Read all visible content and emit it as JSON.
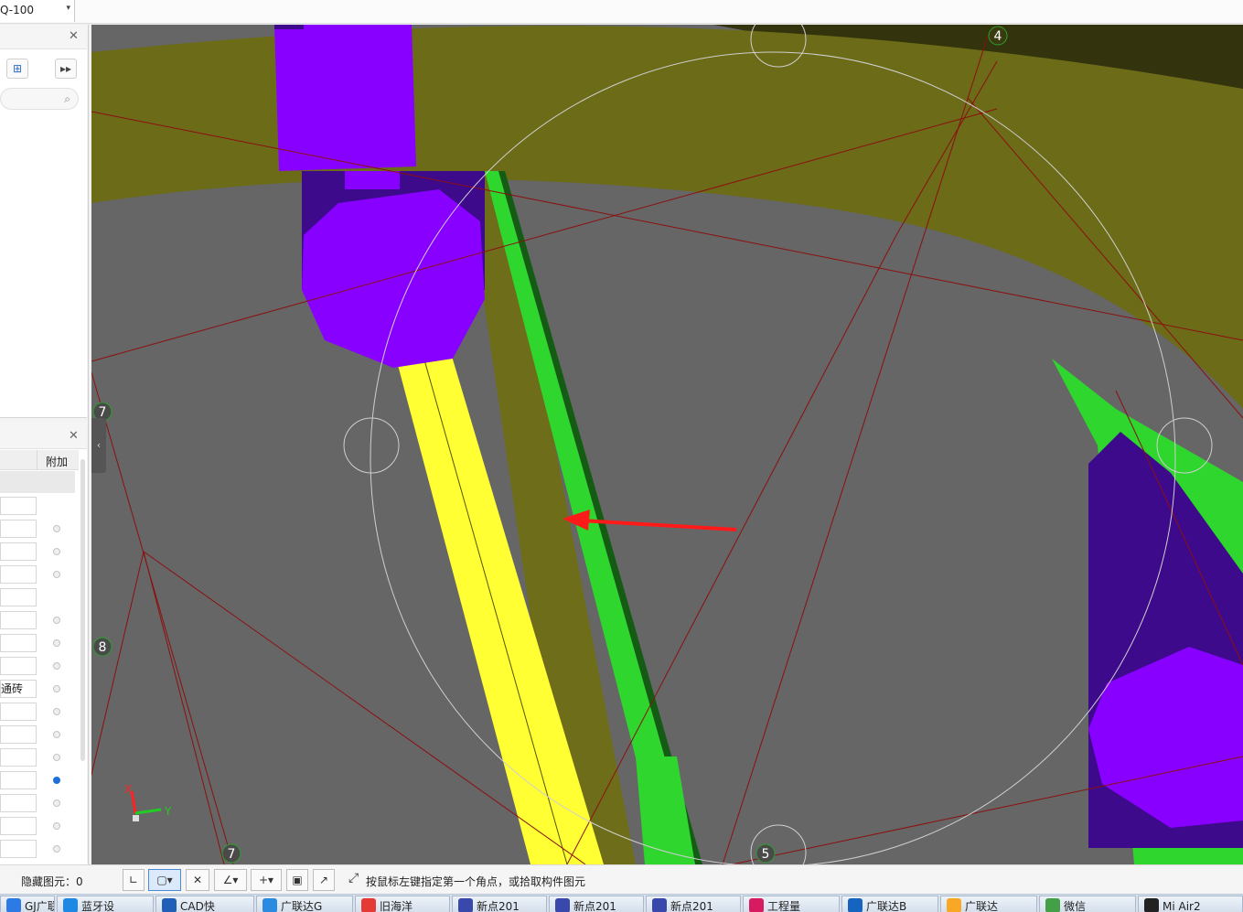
{
  "toolbar": {
    "combo_value": "Q-100"
  },
  "left_panel_top": {
    "search_placeholder": ""
  },
  "left_panel_props": {
    "column_header": "附加",
    "rows": [
      {
        "value": "",
        "checked": null
      },
      {
        "value": "",
        "checked": false
      },
      {
        "value": "",
        "checked": false
      },
      {
        "value": "",
        "checked": false
      },
      {
        "value": "",
        "checked": null
      },
      {
        "value": "",
        "checked": false
      },
      {
        "value": "",
        "checked": false
      },
      {
        "value": "",
        "checked": false
      },
      {
        "value": "通砖",
        "checked": false
      },
      {
        "value": "",
        "checked": false
      },
      {
        "value": "",
        "checked": false
      },
      {
        "value": "",
        "checked": false
      },
      {
        "value": "",
        "checked": true
      },
      {
        "value": "",
        "checked": false
      },
      {
        "value": "",
        "checked": false
      },
      {
        "value": "",
        "checked": false
      }
    ]
  },
  "viewport": {
    "axis_labels": [
      {
        "id": "axis-4",
        "text": "4"
      },
      {
        "id": "axis-7-left",
        "text": "7"
      },
      {
        "id": "axis-8",
        "text": "8"
      },
      {
        "id": "axis-7-bottom",
        "text": "7"
      },
      {
        "id": "axis-5",
        "text": "5"
      }
    ],
    "gizmo": {
      "x": "X",
      "y": "Y"
    },
    "colors": {
      "background": "#666666",
      "ring_beam": "#6b6b18",
      "column": "#8800ff",
      "column_dark": "#3e0a8c",
      "wall_yellow": "#ffff33",
      "wall_olive": "#6e6e1a",
      "wall_green": "#2ed62e",
      "wall_green_dark": "#145c14",
      "grid_line": "#8b1010",
      "arrow": "#ff1a1a"
    }
  },
  "statusbar": {
    "hidden_count": "隐藏图元：0",
    "hint": "按鼠标左键指定第一个角点，或拾取构件图元"
  },
  "taskbar": {
    "items": [
      {
        "label": "GJ广联",
        "color": "#2c7be5"
      },
      {
        "label": "蓝牙设",
        "color": "#1e88e5"
      },
      {
        "label": "CAD快",
        "color": "#1f5fb8"
      },
      {
        "label": "广联达G",
        "color": "#2a8be0"
      },
      {
        "label": "旧海洋",
        "color": "#e53935"
      },
      {
        "label": "新点201",
        "color": "#3949ab"
      },
      {
        "label": "新点201",
        "color": "#3949ab"
      },
      {
        "label": "新点201",
        "color": "#3949ab"
      },
      {
        "label": "工程量",
        "color": "#d81b60"
      },
      {
        "label": "广联达B",
        "color": "#1565c0"
      },
      {
        "label": "广联达",
        "color": "#f9a825"
      },
      {
        "label": "微信",
        "color": "#43a047"
      },
      {
        "label": "Mi Air2",
        "color": "#222222"
      }
    ]
  }
}
